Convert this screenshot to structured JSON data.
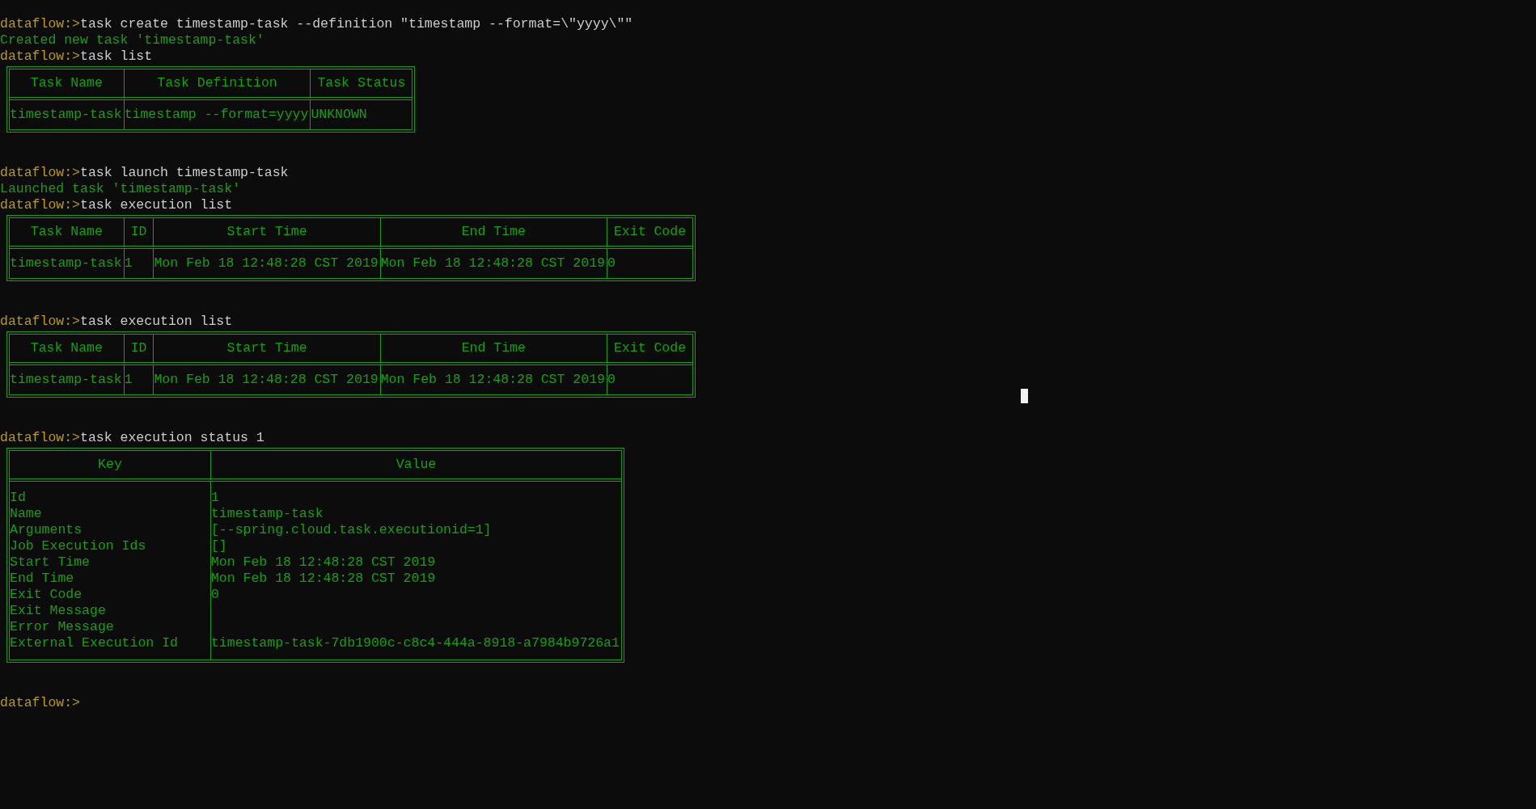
{
  "lines": [
    {
      "kind": "command",
      "prompt": "dataflow:>",
      "text": "task create timestamp-task --definition \"timestamp --format=\\\"yyyy\\\"\""
    },
    {
      "kind": "output",
      "text": "Created new task 'timestamp-task'"
    },
    {
      "kind": "command",
      "prompt": "dataflow:>",
      "text": "task list"
    },
    {
      "kind": "table",
      "columns": [
        "Task Name",
        "Task Definition",
        "Task Status"
      ],
      "rows": [
        [
          "timestamp-task",
          "timestamp --format=yyyy",
          "UNKNOWN"
        ]
      ]
    },
    {
      "kind": "command",
      "prompt": "dataflow:>",
      "text": "task launch timestamp-task"
    },
    {
      "kind": "output",
      "text": "Launched task 'timestamp-task'"
    },
    {
      "kind": "command",
      "prompt": "dataflow:>",
      "text": "task execution list"
    },
    {
      "kind": "table",
      "columns": [
        "Task Name",
        "ID",
        "Start Time",
        "End Time",
        "Exit Code"
      ],
      "rows": [
        [
          "timestamp-task",
          "1",
          "Mon Feb 18 12:48:28 CST 2019",
          "Mon Feb 18 12:48:28 CST 2019",
          "0"
        ]
      ]
    },
    {
      "kind": "command",
      "prompt": "dataflow:>",
      "text": "task execution list"
    },
    {
      "kind": "table",
      "columns": [
        "Task Name",
        "ID",
        "Start Time",
        "End Time",
        "Exit Code"
      ],
      "rows": [
        [
          "timestamp-task",
          "1",
          "Mon Feb 18 12:48:28 CST 2019",
          "Mon Feb 18 12:48:28 CST 2019",
          "0"
        ]
      ]
    },
    {
      "kind": "command",
      "prompt": "dataflow:>",
      "text": "task execution status 1"
    },
    {
      "kind": "kv_table",
      "columns": [
        "Key",
        "Value"
      ],
      "rows": [
        {
          "key": "Id",
          "value": "1"
        },
        {
          "key": "Name",
          "value": "timestamp-task"
        },
        {
          "key": "Arguments",
          "value": "[--spring.cloud.task.executionid=1]"
        },
        {
          "key": "Job Execution Ids",
          "value": "[]"
        },
        {
          "key": "Start Time",
          "value": "Mon Feb 18 12:48:28 CST 2019"
        },
        {
          "key": "End Time",
          "value": "Mon Feb 18 12:48:28 CST 2019"
        },
        {
          "key": "Exit Code",
          "value": "0"
        },
        {
          "key": "Exit Message"
        },
        {
          "key": "Error Message"
        },
        {
          "key": "External Execution Id",
          "value": "timestamp-task-7db1900c-c8c4-444a-8918-a7984b9726a1"
        }
      ]
    },
    {
      "kind": "command",
      "prompt": "dataflow:>"
    }
  ]
}
